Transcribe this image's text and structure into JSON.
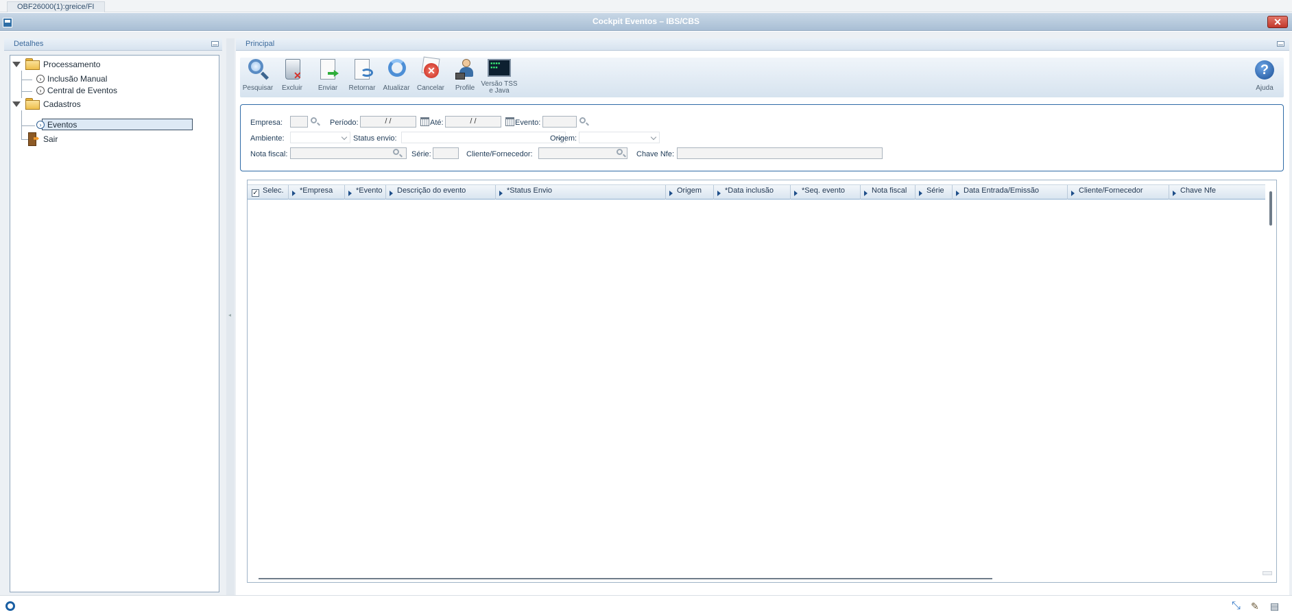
{
  "app_tab": "OBF26000(1):greice/FI",
  "window": {
    "title": "Cockpit Eventos – IBS/CBS",
    "close_label": "✕"
  },
  "left_panel": {
    "title": "Detalhes",
    "tree": [
      {
        "label": "Processamento",
        "type": "folder"
      },
      {
        "label": "Inclusão Manual",
        "type": "item"
      },
      {
        "label": "Central de Eventos",
        "type": "item"
      },
      {
        "label": "Cadastros",
        "type": "folder"
      },
      {
        "label": "Eventos",
        "type": "item",
        "selected": true
      },
      {
        "label": "Sair",
        "type": "exit"
      }
    ]
  },
  "right_panel": {
    "title": "Principal",
    "toolbar": [
      {
        "label": "Pesquisar",
        "icon": "search-icon"
      },
      {
        "label": "Excluir",
        "icon": "trash-icon"
      },
      {
        "label": "Enviar",
        "icon": "send-icon"
      },
      {
        "label": "Retornar",
        "icon": "return-icon"
      },
      {
        "label": "Atualizar",
        "icon": "refresh-icon"
      },
      {
        "label": "Cancelar",
        "icon": "cancel-icon"
      },
      {
        "label": "Profile",
        "icon": "profile-icon"
      },
      {
        "label": "Versão TSS e Java",
        "icon": "terminal-icon"
      }
    ],
    "help_label": "Ajuda"
  },
  "filters": {
    "empresa_label": "Empresa:",
    "empresa_value": "",
    "periodo_label": "Período:",
    "periodo_value": " / /",
    "ate_label": "Até:",
    "ate_value": " / /",
    "evento_label": "Evento:",
    "evento_value": "",
    "ambiente_label": "Ambiente:",
    "status_envio_label": "Status envio:",
    "origem_label": "Origem:",
    "nota_fiscal_label": "Nota fiscal:",
    "serie_label": "Série:",
    "cliente_fornecedor_label": "Cliente/Fornecedor:",
    "chave_nfe_label": "Chave Nfe:"
  },
  "grid": {
    "select_all_checked": true,
    "columns": [
      "Selec.",
      "*Empresa",
      "*Evento",
      "Descrição do evento",
      "*Status Envio",
      "Origem",
      "*Data inclusão",
      "*Seq. evento",
      "Nota fiscal",
      "Série",
      "Data Entrada/Emissão",
      "Cliente/Fornecedor",
      "Chave Nfe"
    ],
    "rows": []
  },
  "colors": {
    "title_bar": "#a9bfd5",
    "accent": "#2e6aa6",
    "close_button": "#c2382b"
  }
}
